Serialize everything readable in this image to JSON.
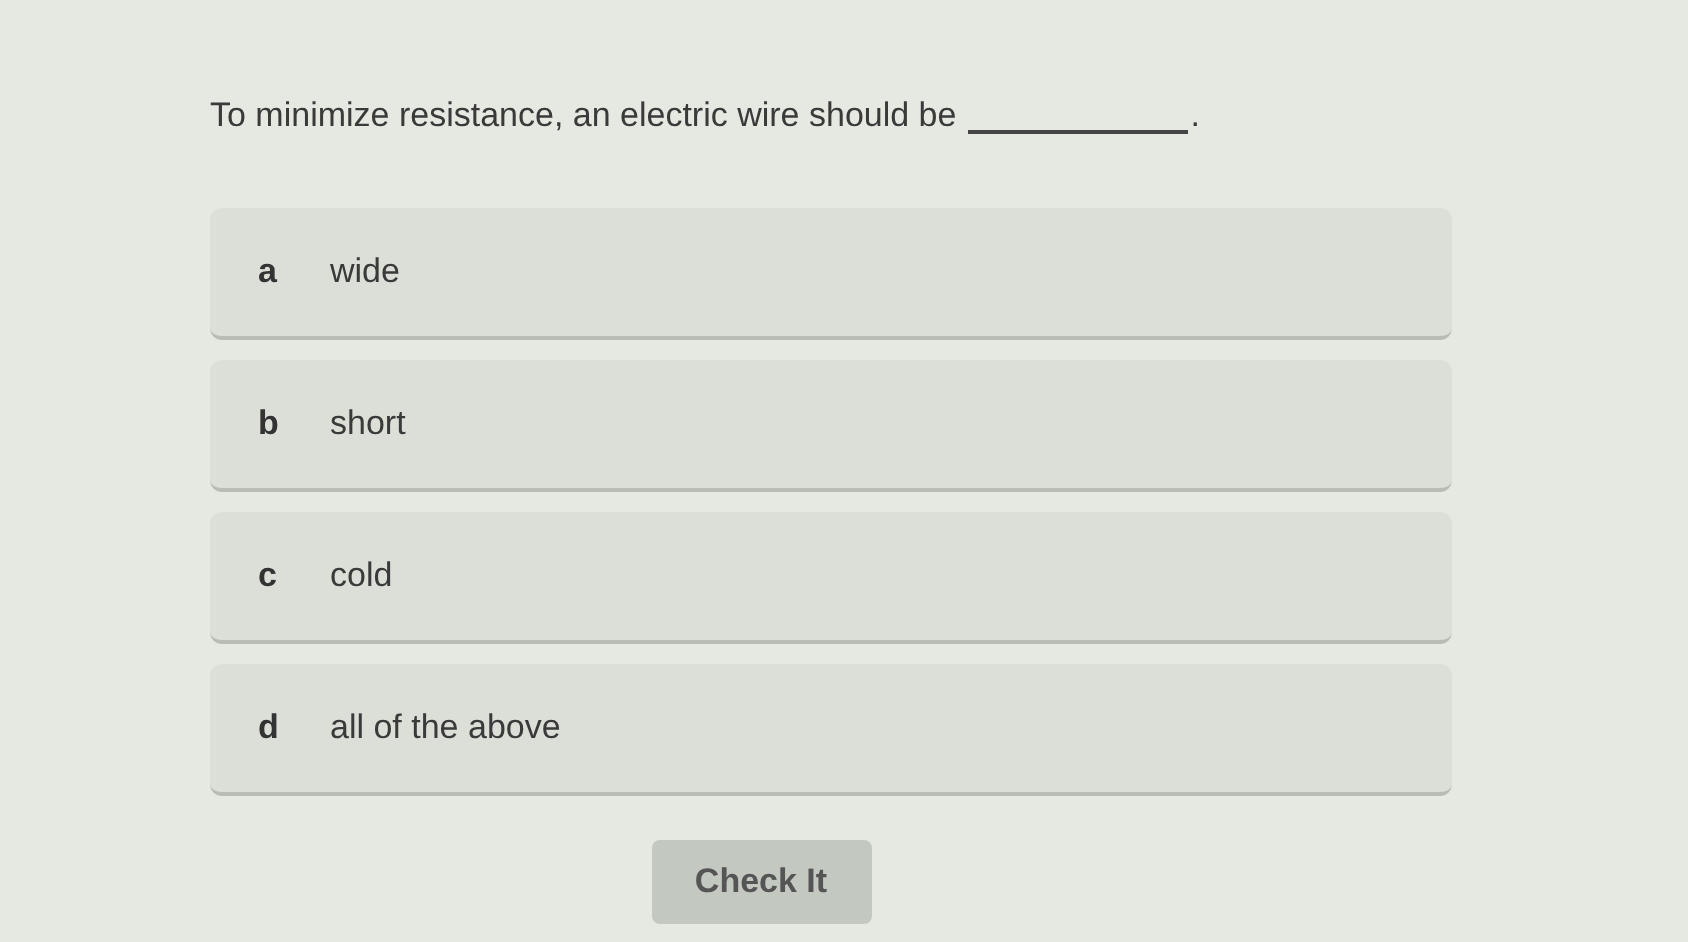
{
  "question": {
    "text": "To minimize resistance, an electric wire should be",
    "end": "."
  },
  "options": [
    {
      "letter": "a",
      "label": "wide",
      "selected": false
    },
    {
      "letter": "b",
      "label": "short",
      "selected": false
    },
    {
      "letter": "c",
      "label": "cold",
      "selected": false
    },
    {
      "letter": "d",
      "label": "all of the above",
      "selected": false
    }
  ],
  "button": {
    "label": "Check It",
    "disabled": true
  }
}
